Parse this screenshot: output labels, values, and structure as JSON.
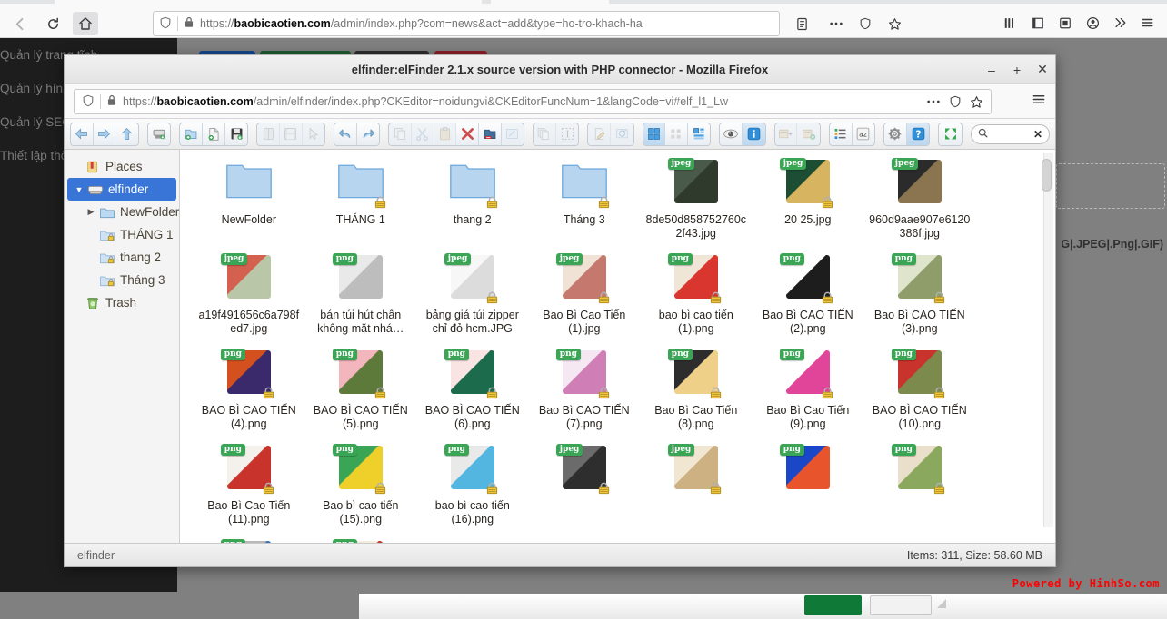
{
  "background": {
    "url_bold": "baobicaotien.com",
    "url_rest": "/admin/index.php?com=news&act=add&type=ho-tro-khach-ha",
    "url_scheme": "https://",
    "sidebar_items": [
      {
        "label": "Quản lý trang tĩnh"
      },
      {
        "label": "Quản lý hình"
      },
      {
        "label": "Quản lý SEO"
      },
      {
        "label": "Thiết lập thô"
      }
    ],
    "collapse_icon": "chevron-left-icon",
    "hint_text": "G|.JPEG|.Png|.GIF)",
    "powered_by": "Powered by HinhSo.com"
  },
  "window": {
    "title": "elfinder:elFinder 2.1.x source version with PHP connector - Mozilla Firefox",
    "minimize_label": "–",
    "maximize_label": "+",
    "close_label": "✕",
    "url_scheme": "https://",
    "url_bold": "baobicaotien.com",
    "url_rest": "/admin/elfinder/index.php?CKEditor=noidungvi&CKEditorFuncNum=1&langCode=vi#elf_l1_Lw",
    "menu_icon": "hamburger-icon"
  },
  "toolbar": {
    "groups": [
      {
        "name": "navigation",
        "buttons": [
          {
            "name": "back-button",
            "icon": "arrow-left-icon",
            "state": "enabled"
          },
          {
            "name": "forward-button",
            "icon": "arrow-right-icon",
            "state": "enabled"
          },
          {
            "name": "up-button",
            "icon": "arrow-up-icon",
            "state": "enabled"
          }
        ]
      },
      {
        "name": "home",
        "buttons": [
          {
            "name": "home-button",
            "icon": "home-disk-icon",
            "state": "enabled"
          }
        ]
      },
      {
        "name": "create",
        "buttons": [
          {
            "name": "new-folder-button",
            "icon": "folder-add-icon",
            "state": "enabled"
          },
          {
            "name": "new-file-button",
            "icon": "file-add-icon",
            "state": "enabled"
          },
          {
            "name": "upload-button",
            "icon": "save-upload-icon",
            "state": "enabled"
          }
        ]
      },
      {
        "name": "open",
        "buttons": [
          {
            "name": "open-button",
            "icon": "book-open-icon",
            "state": "disabled"
          },
          {
            "name": "download-button",
            "icon": "floppy-icon",
            "state": "disabled"
          },
          {
            "name": "select-button",
            "icon": "cursor-icon",
            "state": "disabled"
          }
        ]
      },
      {
        "name": "history",
        "buttons": [
          {
            "name": "undo-button",
            "icon": "undo-icon",
            "state": "enabled"
          },
          {
            "name": "redo-button",
            "icon": "redo-icon",
            "state": "enabled"
          }
        ]
      },
      {
        "name": "clipboard",
        "buttons": [
          {
            "name": "copy-button",
            "icon": "copy-icon",
            "state": "disabled"
          },
          {
            "name": "cut-button",
            "icon": "scissors-icon",
            "state": "disabled"
          },
          {
            "name": "paste-button",
            "icon": "clipboard-icon",
            "state": "disabled"
          },
          {
            "name": "delete-button",
            "icon": "red-x-icon",
            "state": "enabled"
          },
          {
            "name": "rm-button",
            "icon": "folder-remove-icon",
            "state": "enabled"
          },
          {
            "name": "empty-button",
            "icon": "broom-icon",
            "state": "disabled"
          }
        ]
      },
      {
        "name": "duplicate",
        "buttons": [
          {
            "name": "duplicate-button",
            "icon": "duplicate-icon",
            "state": "disabled"
          },
          {
            "name": "rename-button",
            "icon": "select-all-icon",
            "state": "disabled"
          }
        ]
      },
      {
        "name": "edit",
        "buttons": [
          {
            "name": "edit-button",
            "icon": "pencil-edit-icon",
            "state": "disabled"
          },
          {
            "name": "resize-button",
            "icon": "image-rotate-icon",
            "state": "disabled"
          }
        ]
      },
      {
        "name": "view",
        "buttons": [
          {
            "name": "view-icons-button",
            "icon": "grid-large-icon",
            "state": "active"
          },
          {
            "name": "view-small-button",
            "icon": "grid-small-icon",
            "state": "enabled"
          },
          {
            "name": "view-list-button",
            "icon": "grid-mixed-icon",
            "state": "enabled"
          }
        ]
      },
      {
        "name": "preview",
        "buttons": [
          {
            "name": "quicklook-button",
            "icon": "eye-icon",
            "state": "enabled"
          },
          {
            "name": "info-button",
            "icon": "info-icon",
            "state": "active"
          }
        ]
      },
      {
        "name": "archive",
        "buttons": [
          {
            "name": "extract-button",
            "icon": "archive-extract-icon",
            "state": "disabled"
          },
          {
            "name": "archive-button",
            "icon": "archive-add-icon",
            "state": "disabled"
          }
        ]
      },
      {
        "name": "sort",
        "buttons": [
          {
            "name": "sort-button",
            "icon": "sort-list-icon",
            "state": "enabled"
          },
          {
            "name": "sort-name-button",
            "icon": "sort-az-icon",
            "state": "enabled"
          }
        ]
      },
      {
        "name": "settings",
        "buttons": [
          {
            "name": "preferences-button",
            "icon": "gear-icon",
            "state": "enabled"
          },
          {
            "name": "help-button",
            "icon": "question-icon",
            "state": "active"
          }
        ]
      },
      {
        "name": "fullscreen",
        "buttons": [
          {
            "name": "fullscreen-button",
            "icon": "expand-arrows-icon",
            "state": "enabled"
          }
        ]
      }
    ],
    "search": {
      "value": "",
      "placeholder": "",
      "search_icon": "magnifier-icon",
      "clear_icon": "close-x-icon"
    }
  },
  "navtree": {
    "items": [
      {
        "label": "Places",
        "icon": "places-bookmark-icon",
        "indent": 0,
        "selected": false,
        "expander": ""
      },
      {
        "label": "elfinder",
        "icon": "disk-icon",
        "indent": 0,
        "selected": true,
        "expander": "▼"
      },
      {
        "label": "NewFolder",
        "icon": "folder-icon",
        "indent": 1,
        "selected": false,
        "expander": "▶"
      },
      {
        "label": "THÁNG 1",
        "icon": "folder-locked-icon",
        "indent": 1,
        "selected": false,
        "expander": ""
      },
      {
        "label": "thang 2",
        "icon": "folder-locked-icon",
        "indent": 1,
        "selected": false,
        "expander": ""
      },
      {
        "label": "Tháng 3",
        "icon": "folder-locked-icon",
        "indent": 1,
        "selected": false,
        "expander": ""
      },
      {
        "label": "Trash",
        "icon": "trash-icon",
        "indent": 0,
        "selected": false,
        "expander": ""
      }
    ]
  },
  "files": [
    {
      "name": "NewFolder",
      "kind": "folder",
      "mime": "",
      "locked": false,
      "colors": [
        "#b7d5ef",
        "#6ea8dd"
      ]
    },
    {
      "name": "THÁNG 1",
      "kind": "folder",
      "mime": "",
      "locked": true,
      "colors": [
        "#b7d5ef",
        "#6ea8dd"
      ]
    },
    {
      "name": "thang 2",
      "kind": "folder",
      "mime": "",
      "locked": true,
      "colors": [
        "#b7d5ef",
        "#6ea8dd"
      ]
    },
    {
      "name": "Tháng 3",
      "kind": "folder",
      "mime": "",
      "locked": true,
      "colors": [
        "#b7d5ef",
        "#6ea8dd"
      ]
    },
    {
      "name": "8de50d858752760c2f43.jpg",
      "kind": "image",
      "mime": "jpeg",
      "locked": false,
      "colors": [
        "#4a5a4a",
        "#2f3a2c"
      ]
    },
    {
      "name": "20 25.jpg",
      "kind": "image",
      "mime": "jpeg",
      "locked": true,
      "colors": [
        "#1d4d32",
        "#d6b460"
      ]
    },
    {
      "name": "960d9aae907e6120386f.jpg",
      "kind": "image",
      "mime": "jpeg",
      "locked": false,
      "colors": [
        "#2b2b2b",
        "#8a7550"
      ]
    },
    {
      "name": "a19f491656c6a798fed7.jpg",
      "kind": "image",
      "mime": "jpeg",
      "locked": false,
      "colors": [
        "#d4614f",
        "#b9c6a8"
      ]
    },
    {
      "name": "bán túi hút chân không mặt nhá…",
      "kind": "image",
      "mime": "png",
      "locked": false,
      "colors": [
        "#e9e9e9",
        "#bdbdbd"
      ]
    },
    {
      "name": "bảng giá túi zipper chỉ đỏ hcm.JPG",
      "kind": "image",
      "mime": "jpeg",
      "locked": true,
      "colors": [
        "#f7f7f7",
        "#dcdcdc"
      ]
    },
    {
      "name": "Bao Bì Cao Tiến (1).jpg",
      "kind": "image",
      "mime": "jpeg",
      "locked": true,
      "colors": [
        "#f0e3d6",
        "#c4786e"
      ]
    },
    {
      "name": "bao bì cao tiến (1).png",
      "kind": "image",
      "mime": "png",
      "locked": true,
      "colors": [
        "#efe6d8",
        "#d8362f"
      ]
    },
    {
      "name": "Bao Bì CAO TIẾN (2).png",
      "kind": "image",
      "mime": "png",
      "locked": true,
      "colors": [
        "#ffffff",
        "#1d1d1d"
      ]
    },
    {
      "name": "Bao Bì CAO TIẾN (3).png",
      "kind": "image",
      "mime": "png",
      "locked": true,
      "colors": [
        "#dfe5cd",
        "#8f9d6a"
      ]
    },
    {
      "name": "BAO BÌ CAO TIẾN (4).png",
      "kind": "image",
      "mime": "png",
      "locked": true,
      "colors": [
        "#d4511f",
        "#3a2a6c"
      ]
    },
    {
      "name": "BAO BÌ CAO TIẾN (5).png",
      "kind": "image",
      "mime": "png",
      "locked": true,
      "colors": [
        "#f3b6bc",
        "#5d7a3a"
      ]
    },
    {
      "name": "BAO BÌ CAO TIẾN (6).png",
      "kind": "image",
      "mime": "png",
      "locked": true,
      "colors": [
        "#fae3e3",
        "#1c6b4c"
      ]
    },
    {
      "name": "Bao Bì CAO TIẾN (7).png",
      "kind": "image",
      "mime": "png",
      "locked": true,
      "colors": [
        "#f5e8f3",
        "#cf7fb5"
      ]
    },
    {
      "name": "Bao Bì Cao Tiến (8).png",
      "kind": "image",
      "mime": "png",
      "locked": true,
      "colors": [
        "#2d2d2d",
        "#efd089"
      ]
    },
    {
      "name": "Bao Bì Cao Tiến (9).png",
      "kind": "image",
      "mime": "png",
      "locked": true,
      "colors": [
        "#ffffff",
        "#e0459a"
      ]
    },
    {
      "name": "BAO BÌ CAO TIẾN (10).png",
      "kind": "image",
      "mime": "png",
      "locked": true,
      "colors": [
        "#c8342b",
        "#7d8a4e"
      ]
    },
    {
      "name": "Bao Bì Cao Tiến (11).png",
      "kind": "image",
      "mime": "png",
      "locked": true,
      "colors": [
        "#f4f0ec",
        "#c8342b"
      ]
    },
    {
      "name": "Bao bì cao tiến (15).png",
      "kind": "image",
      "mime": "png",
      "locked": true,
      "colors": [
        "#3aa655",
        "#efd02a"
      ]
    },
    {
      "name": "bao bì cao tiến (16).png",
      "kind": "image",
      "mime": "png",
      "locked": true,
      "colors": [
        "#e9e9e9",
        "#52b6e0"
      ]
    },
    {
      "name": "",
      "kind": "image",
      "mime": "jpeg",
      "locked": true,
      "colors": [
        "#6b6b6b",
        "#2e2e2e"
      ]
    },
    {
      "name": "",
      "kind": "image",
      "mime": "jpeg",
      "locked": true,
      "colors": [
        "#f1e6d2",
        "#cdb183"
      ]
    },
    {
      "name": "",
      "kind": "image",
      "mime": "png",
      "locked": false,
      "colors": [
        "#1a46c8",
        "#e8542b"
      ]
    },
    {
      "name": "",
      "kind": "image",
      "mime": "png",
      "locked": true,
      "colors": [
        "#eadfcb",
        "#8aa95e"
      ]
    },
    {
      "name": "",
      "kind": "image",
      "mime": "png",
      "locked": true,
      "colors": [
        "#b9b9b9",
        "#3a6fb0"
      ]
    },
    {
      "name": "",
      "kind": "image",
      "mime": "png",
      "locked": true,
      "colors": [
        "#f5ece0",
        "#c8342b"
      ]
    }
  ],
  "statusbar": {
    "path": "elfinder",
    "stats": "Items: 311, Size: 58.60 MB"
  }
}
